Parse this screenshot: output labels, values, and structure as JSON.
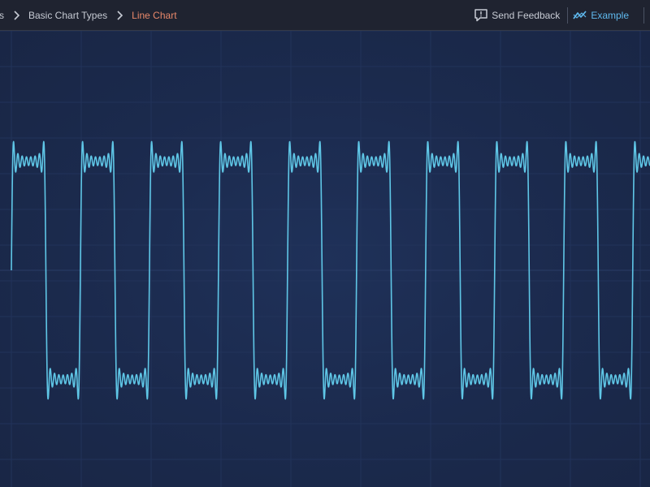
{
  "breadcrumb": {
    "items": [
      "s",
      "Basic Chart Types",
      "Line Chart"
    ]
  },
  "toolbar": {
    "send_feedback_label": "Send Feedback",
    "example_label": "Example",
    "icons": [
      "chevron-right-icon",
      "feedback-icon",
      "trend-line-icon"
    ]
  },
  "colors": {
    "background": "#1c2a4a",
    "toolbar": "#1f2330",
    "series": "#5fc6e6",
    "accent": "#5fb9ee",
    "active_crumb": "#e8886a"
  },
  "chart_data": {
    "type": "line",
    "title": "",
    "xlabel": "",
    "ylabel": "",
    "grid": true,
    "legend": "none",
    "series": [
      {
        "harmonics": [
          1,
          3,
          5,
          7,
          9,
          11,
          13,
          15
        ],
        "periods_shown": 9.25,
        "xlim": [
          0,
          9.25
        ],
        "ylim": [
          -1.6,
          1.6
        ]
      }
    ]
  }
}
